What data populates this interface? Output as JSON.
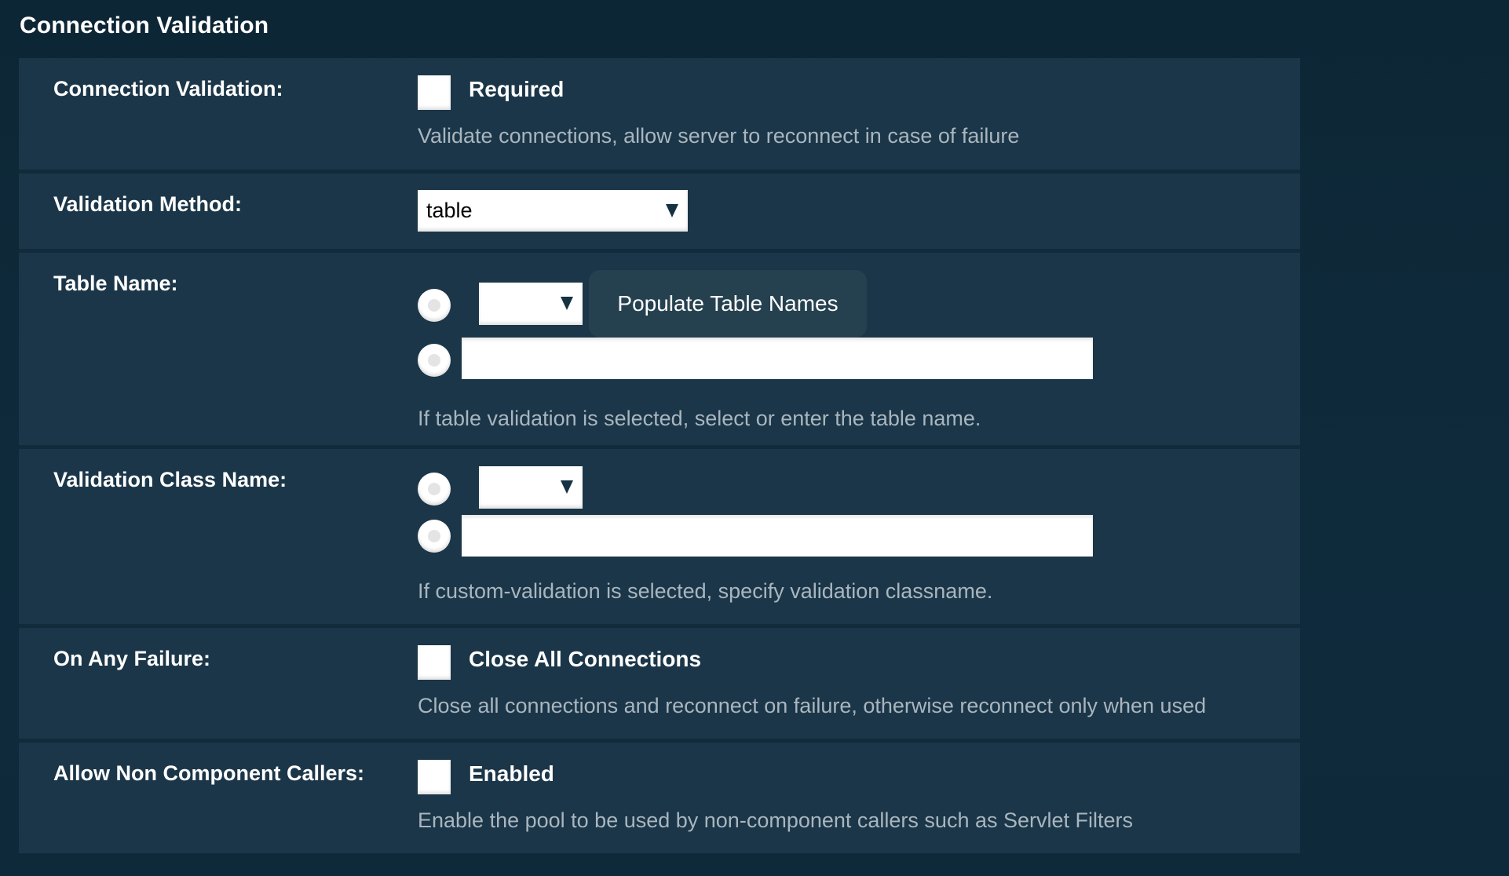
{
  "section": {
    "title": "Connection Validation"
  },
  "rows": {
    "connection_validation": {
      "label": "Connection Validation:",
      "checkbox_label": "Required",
      "checked": false,
      "help": "Validate connections, allow server to reconnect in case of failure"
    },
    "validation_method": {
      "label": "Validation Method:",
      "selected": "table",
      "arrow_icon": "dropdown-triangle"
    },
    "table_name": {
      "label": "Table Name:",
      "select_value": "",
      "populate_button": "Populate Table Names",
      "text_value": "",
      "help": "If table validation is selected, select or enter the table name."
    },
    "validation_class_name": {
      "label": "Validation Class Name:",
      "select_value": "",
      "text_value": "",
      "help": "If custom-validation is selected, specify validation classname."
    },
    "on_any_failure": {
      "label": "On Any Failure:",
      "checkbox_label": "Close All Connections",
      "checked": false,
      "help": "Close all connections and reconnect on failure, otherwise reconnect only when used"
    },
    "allow_non_component_callers": {
      "label": "Allow Non Component Callers:",
      "checkbox_label": "Enabled",
      "checked": false,
      "help": "Enable the pool to be used by non-component callers such as Servlet Filters"
    }
  },
  "colors": {
    "page_bg": "#0e2a3a",
    "row_bg": "#1b3648",
    "button_bg": "#25414f",
    "help_text": "#a9b6bf"
  }
}
